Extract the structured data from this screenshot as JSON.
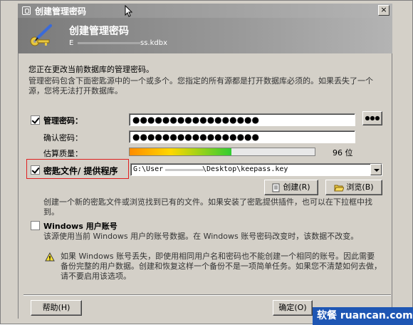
{
  "window": {
    "title": "创建管理密码",
    "close_glyph": "×"
  },
  "banner": {
    "title": "创建管理密码",
    "subtitle_start": "E",
    "subtitle_end": "ss.kdbx"
  },
  "intro": {
    "line1": "您正在更改当前数据库的管理密码。",
    "line2": "管理密码包含下面密匙源中的一个或多个。您指定的所有源都是打开数据库必须的。如果丢失了一个源，您将无法打开数据库。"
  },
  "master_password": {
    "label": "管理密码：",
    "checked": true,
    "value": "●●●●●●●●●●●●●●●●●",
    "reveal_button": "●●●"
  },
  "confirm_password": {
    "label": "确认密码：",
    "value": "●●●●●●●●●●●●●●●●●"
  },
  "quality": {
    "label": "估算质量：",
    "bits_text": "96 位",
    "fill_fraction": 0.55
  },
  "key_file": {
    "label": "密匙文件/ 提供程序",
    "checked": true,
    "path_start": "G:\\User",
    "path_end": "\\Desktop\\keepass.key",
    "create_button": "创建(R)",
    "browse_button": "浏览(B)",
    "hint": "创建一个新的密匙文件或浏览找到已有的文件。如果安装了密匙提供插件，也可以在下拉框中找到。"
  },
  "windows_account": {
    "label": "Windows 用户账号",
    "checked": false,
    "desc": "该源使用当前 Windows 用户的账号数据。在 Windows 账号密码改变时，该数据不改变。",
    "warning": "如果 Windows 账号丢失，即使用相同用户名和密码也不能创建一个相同的账号。因此需要备份完整的用户数据。创建和恢复这样一个备份不是一项简单任务。如果您不清楚如何去做，请不要启用该选项。"
  },
  "footer": {
    "help_button": "帮助(H)",
    "ok_button": "确定(O)"
  },
  "watermark": {
    "text": "软餐 ruancan.com"
  },
  "icons": {
    "title": "lock-icon",
    "banner": "key-pen-icon",
    "create": "new-file-icon",
    "browse": "folder-open-icon",
    "warning": "warning-icon"
  }
}
